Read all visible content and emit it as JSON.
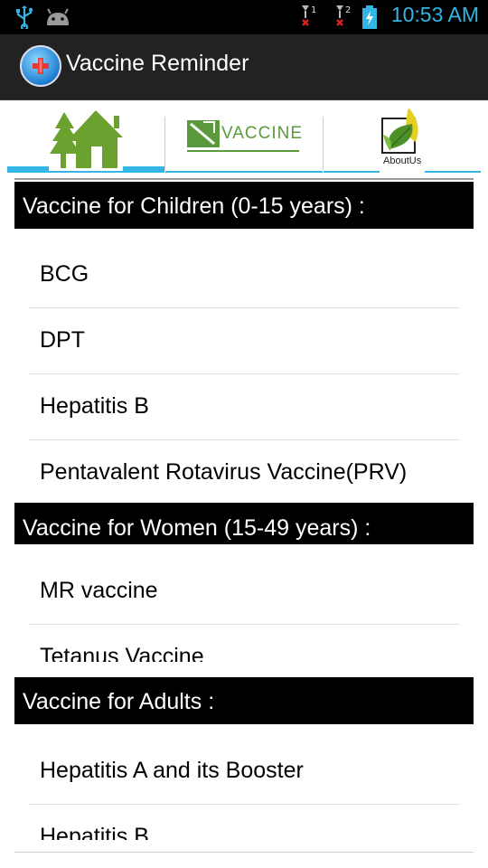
{
  "status_bar": {
    "time": "10:53 AM",
    "signal_labels": [
      "1",
      "2"
    ],
    "icons": [
      "usb-icon",
      "android-icon",
      "signal-1-icon",
      "signal-2-icon",
      "battery-charging-icon"
    ]
  },
  "action_bar": {
    "title": "Vaccine Reminder",
    "icon": "app-logo-icon"
  },
  "tabs": [
    {
      "name": "home",
      "icon": "home-icon"
    },
    {
      "name": "vaccine",
      "label": "VACCINE",
      "icon": "vaccine-logo-icon"
    },
    {
      "name": "about",
      "label": "AboutUs",
      "icon": "about-us-leaf-icon"
    }
  ],
  "sections": [
    {
      "header": "Vaccine for Children (0-15 years) :",
      "items": [
        "BCG",
        "DPT",
        "Hepatitis B",
        "Pentavalent Rotavirus Vaccine(PRV)"
      ]
    },
    {
      "header": "Vaccine for Women (15-49 years) :",
      "items": [
        "MR vaccine",
        "Tetanus Vaccine"
      ]
    },
    {
      "header": "Vaccine for Adults :",
      "items": [
        "Hepatitis A and its Booster",
        "Hepatitis B"
      ]
    }
  ],
  "colors": {
    "accent": "#33b5e5",
    "action_bar": "#222222",
    "section_header_bg": "#000000",
    "vaccine_green": "#5a9a3c"
  }
}
